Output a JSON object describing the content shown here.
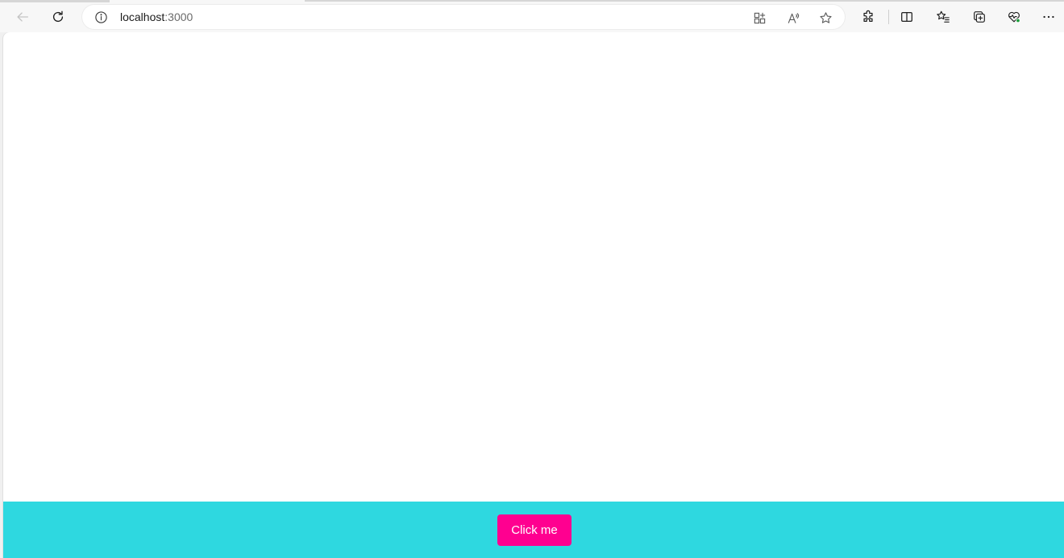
{
  "browser": {
    "address_bar": {
      "host": "localhost",
      "port": ":3000"
    },
    "icons": {
      "back": "back-arrow-icon",
      "reload": "reload-icon",
      "site_info": "info-icon",
      "app_available": "app-available-icon",
      "read_aloud": "read-aloud-icon",
      "favorite": "star-icon",
      "extensions": "puzzle-icon",
      "split_screen": "split-screen-icon",
      "favorites": "favorites-list-icon",
      "collections": "collections-icon",
      "browser_essentials": "heart-pulse-icon",
      "more": "more-icon"
    }
  },
  "page": {
    "button_label": "Click me"
  },
  "colors": {
    "footer_bg": "#2ed8e0",
    "button_bg": "#ff0090",
    "button_text": "#ffffff",
    "page_bg": "#ffffff",
    "essentials_badge": "#1a9e3a"
  }
}
